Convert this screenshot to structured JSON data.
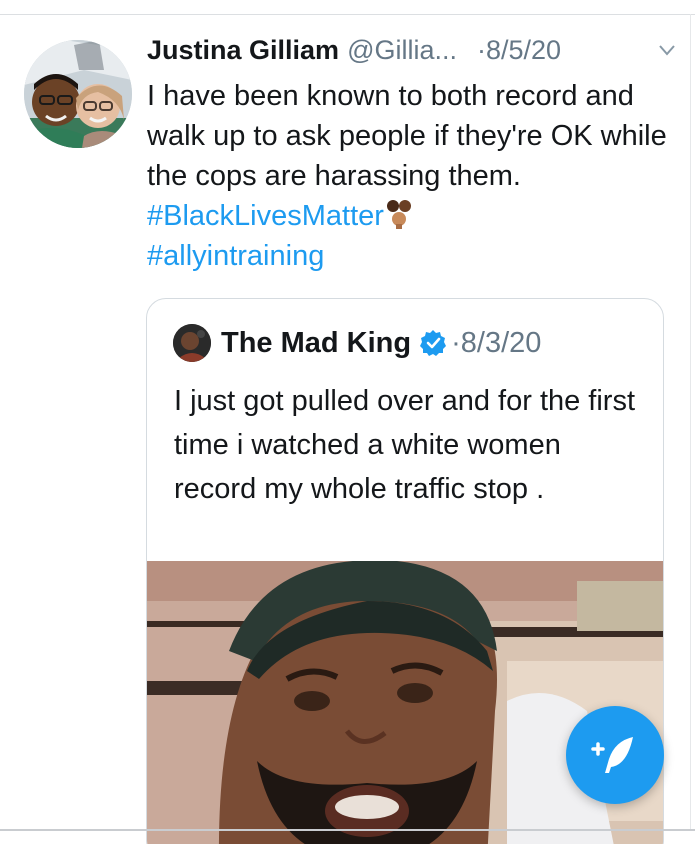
{
  "tweet": {
    "author_name": "Justina Gilliam",
    "handle": "@Gillia...",
    "separator": "·",
    "date": "8/5/20",
    "text_main": "I have been known to both record and walk up to ask people if they're OK while the cops are harassing them. ",
    "hashtag_1": "#BlackLivesMatter",
    "hashtag_2": "#allyintraining",
    "hashtag_color": "#1d9bf0"
  },
  "quoted_tweet": {
    "author_name": "The Mad King",
    "separator": "·",
    "date": "8/3/20",
    "text": "I just got pulled over and for the first time i watched a white women record my whole traffic stop ."
  },
  "icons": {
    "caret": "chevron-down-icon",
    "verified": "verified-badge-icon",
    "compose": "compose-tweet-icon",
    "emoji": "raised-fists-emoji"
  },
  "colors": {
    "text": "#14171a",
    "secondary": "#657786",
    "accent": "#1d9bf0"
  }
}
